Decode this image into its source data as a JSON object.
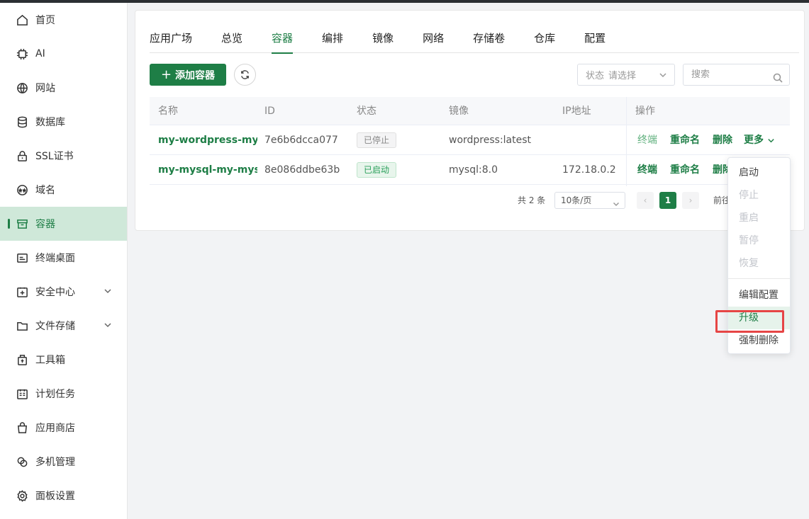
{
  "sidebar": {
    "items": [
      {
        "label": "首页",
        "icon": "home-icon"
      },
      {
        "label": "AI",
        "icon": "chip-icon"
      },
      {
        "label": "网站",
        "icon": "globe-icon"
      },
      {
        "label": "数据库",
        "icon": "database-icon"
      },
      {
        "label": "SSL证书",
        "icon": "lock-icon"
      },
      {
        "label": "域名",
        "icon": "www-icon"
      },
      {
        "label": "容器",
        "icon": "box-icon"
      },
      {
        "label": "终端桌面",
        "icon": "terminal-icon"
      },
      {
        "label": "安全中心",
        "icon": "shield-plus-icon"
      },
      {
        "label": "文件存储",
        "icon": "folder-icon"
      },
      {
        "label": "工具箱",
        "icon": "toolbox-icon"
      },
      {
        "label": "计划任务",
        "icon": "calendar-icon"
      },
      {
        "label": "应用商店",
        "icon": "bag-icon"
      },
      {
        "label": "多机管理",
        "icon": "link-icon"
      },
      {
        "label": "面板设置",
        "icon": "gear-icon"
      }
    ]
  },
  "tabs": [
    "应用广场",
    "总览",
    "容器",
    "编排",
    "镜像",
    "网络",
    "存储卷",
    "仓库",
    "配置"
  ],
  "toolbar": {
    "add_label": "添加容器",
    "status_label": "状态",
    "status_placeholder": "请选择",
    "search_placeholder": "搜索"
  },
  "table": {
    "headers": [
      "名称",
      "ID",
      "状态",
      "镜像",
      "IP地址",
      "操作"
    ],
    "rows": [
      {
        "name": "my-wordpress-my-wordpress",
        "id": "7e6b6dcca077",
        "status": "已停止",
        "image": "wordpress:latest",
        "ip": ""
      },
      {
        "name": "my-mysql-my-mysql",
        "id": "8e086ddbe63b",
        "status": "已启动",
        "image": "mysql:8.0",
        "ip": "172.18.0.2"
      }
    ],
    "ops": {
      "terminal": "终端",
      "rename": "重命名",
      "delete": "删除",
      "more": "更多"
    }
  },
  "pagination": {
    "total": "共 2 条",
    "page_size": "10条/页",
    "current": "1",
    "goto": "前往"
  },
  "dropdown": {
    "items": [
      "启动",
      "停止",
      "重启",
      "暂停",
      "恢复",
      "编辑配置",
      "升级",
      "强制删除"
    ]
  },
  "colors": {
    "accent": "#1e7e46",
    "highlight_border": "#e64545"
  }
}
